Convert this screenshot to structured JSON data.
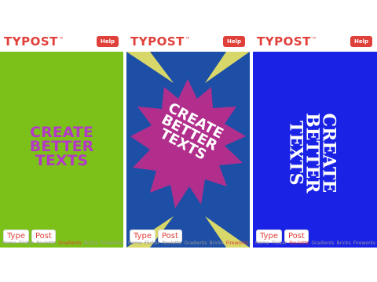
{
  "panels": [
    {
      "logo": "TYPOST",
      "tm": "™",
      "help_label": "Help",
      "headline": [
        "CREATE",
        "BETTER",
        "TEXTS"
      ],
      "type_label": "Type",
      "post_label": "Post",
      "background": "#7cc11a",
      "text_color": "#b339c6",
      "nav": [
        "Home",
        "Flicker",
        "Roulette",
        "Gradients",
        "Bricks",
        "Fireworks"
      ],
      "active_nav": "Gradients"
    },
    {
      "logo": "TYPOST",
      "tm": "™",
      "help_label": "Help",
      "headline": [
        "CREATE",
        "BETTER",
        "TEXTS"
      ],
      "type_label": "Type",
      "post_label": "Post",
      "background": "#1e4fa6",
      "star_color": "#b12e8c",
      "text_color": "#ffffff",
      "nav": [
        "Home",
        "Flicker",
        "Roulette",
        "Gradients",
        "Bricks",
        "Fireworks"
      ],
      "active_nav": "Fireworks"
    },
    {
      "logo": "TYPOST",
      "tm": "™",
      "help_label": "Help",
      "headline": [
        "CREATE",
        "BETTER",
        "TEXTS"
      ],
      "type_label": "Type",
      "post_label": "Post",
      "background": "#1a22e6",
      "text_color": "#ffffff",
      "nav": [
        "Home",
        "Flicker",
        "Roulette",
        "Gradients",
        "Bricks",
        "Fireworks"
      ],
      "active_nav": "Roulette"
    }
  ]
}
